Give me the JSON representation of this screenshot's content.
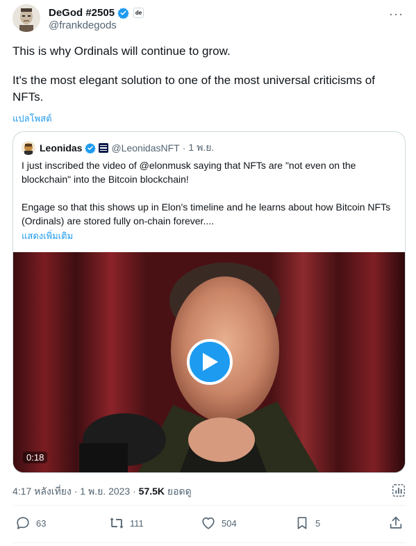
{
  "author": {
    "display_name": "DeGod #2505",
    "handle": "@frankdegods",
    "affiliate_badge": "de",
    "verified_icon": "verified-badge-icon"
  },
  "tweet": {
    "paragraph1": "This is why Ordinals will continue to grow.",
    "paragraph2": "It's the most elegant solution to one of the most universal criticisms of NFTs.",
    "translate_link": "แปลโพสต์"
  },
  "quoted": {
    "display_name": "Leonidas",
    "handle": "@LeonidasNFT",
    "separator": "·",
    "date": "1 พ.ย.",
    "paragraph1": "I just inscribed the video of @elonmusk saying that NFTs are \"not even on the blockchain\" into the Bitcoin blockchain!",
    "paragraph2": "Engage so that this shows up in Elon's timeline and he learns about how Bitcoin NFTs (Ordinals) are stored fully on-chain forever....",
    "show_more": "แสดงเพิ่มเติม",
    "video": {
      "duration": "0:18",
      "play_icon": "play-icon"
    }
  },
  "meta": {
    "time": "4:17 หลังเที่ยง",
    "date": "1 พ.ย. 2023",
    "views_count": "57.5K",
    "views_label": "ยอดดู",
    "sep": "·"
  },
  "actions": {
    "replies": "63",
    "reposts": "111",
    "likes": "504",
    "bookmarks": "5"
  },
  "colors": {
    "accent": "#1d9bf0",
    "text_primary": "#0f1419",
    "text_secondary": "#536471",
    "border": "#cfd9de"
  }
}
